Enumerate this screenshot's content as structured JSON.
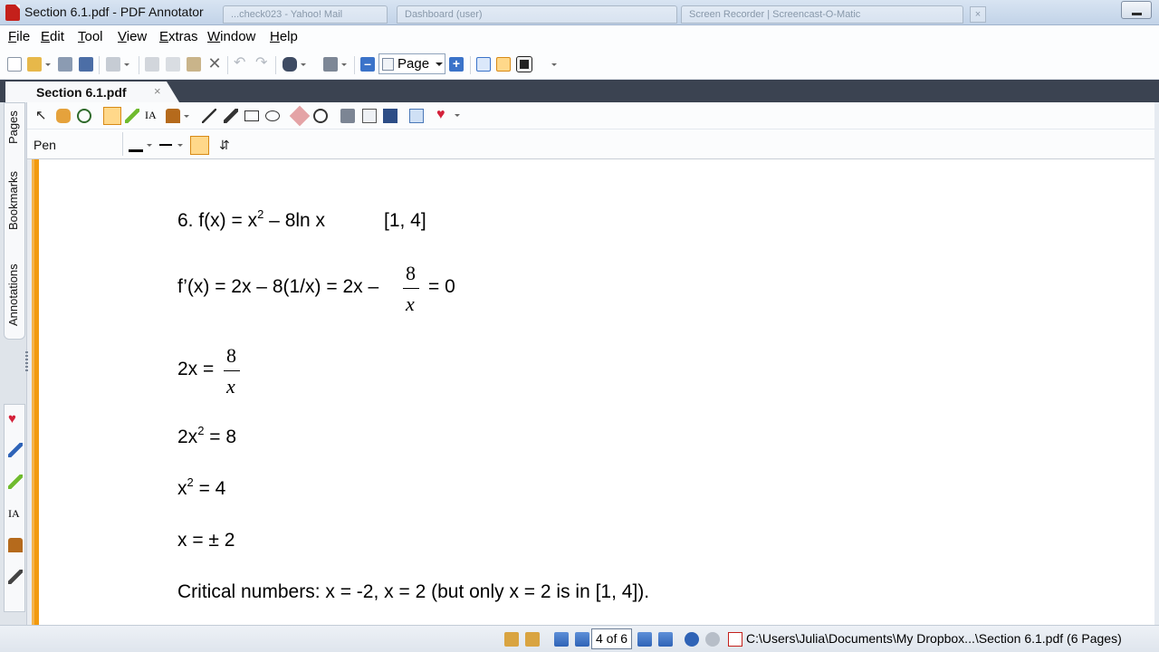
{
  "window": {
    "title": "Section 6.1.pdf - PDF Annotator",
    "background_tabs": [
      "...check023 - Yahoo! Mail",
      "Dashboard (user)",
      "Screen Recorder | Screencast-O-Matic"
    ]
  },
  "menu": {
    "items": [
      "File",
      "Edit",
      "Tool",
      "View",
      "Extras",
      "Window",
      "Help"
    ]
  },
  "toolbar": {
    "page_fit_value": "Page"
  },
  "document_tab": {
    "label": "Section 6.1.pdf",
    "close_glyph": "×"
  },
  "side_tabs": [
    "Pages",
    "Bookmarks",
    "Annotations"
  ],
  "pen_toolbar": {
    "tool_label": "Pen"
  },
  "document": {
    "problem_number": "6. f(x) = x",
    "problem_exp": "2",
    "problem_rest": " – 8ln x",
    "interval": "[1, 4]",
    "derivative_text": "f’(x) = 2x – 8(1/x) = 2x –",
    "derivative_frac_num": "8",
    "derivative_frac_den": "x",
    "derivative_tail": "= 0",
    "step1_left": "2x =",
    "step1_frac_num": "8",
    "step1_frac_den": "x",
    "step2_base": "2x",
    "step2_exp": "2",
    "step2_tail": " = 8",
    "step3_base": "x",
    "step3_exp": "2",
    "step3_tail": " = 4",
    "step4": "x = ± 2",
    "conclusion": "Critical numbers: x = -2, x = 2 (but only x = 2 is in [1, 4])."
  },
  "statusbar": {
    "page_counter": "4 of 6",
    "file_path": "C:\\Users\\Julia\\Documents\\My Dropbox...\\Section 6.1.pdf (6 Pages)"
  },
  "colors": {
    "accent_orange": "#f29a0e",
    "tab_band": "#3b4351",
    "app_red": "#c4201b"
  }
}
